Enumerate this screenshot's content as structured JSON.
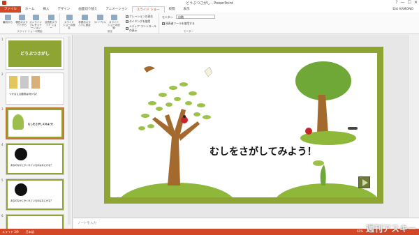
{
  "window": {
    "title": "どうぶつさがし - PowerPoint",
    "controls": [
      "?",
      "—",
      "☐",
      "✕"
    ]
  },
  "tabs": [
    "ファイル",
    "ホーム",
    "挿入",
    "デザイン",
    "画面切り替え",
    "アニメーション",
    "スライド ショー",
    "校閲",
    "表示"
  ],
  "active_tab": "スライド ショー",
  "user": "Eiki KAMONO",
  "ribbon": {
    "group_start": {
      "label": "スライド ショーの開始",
      "buttons": [
        "最初から",
        "現在のスライドから",
        "オンライン プレゼンテーション",
        "目的別スライド ショー"
      ]
    },
    "group_setup": {
      "label": "設定",
      "buttons": [
        "スライド ショーの設定",
        "非表示スライドに設定",
        "リハーサル",
        "スライド ショーの記録"
      ]
    },
    "checkboxes": [
      "ナレーションの再生",
      "タイミングを使用",
      "メディア コントロールの表示"
    ],
    "group_monitor": {
      "label": "モニター",
      "monitor_label": "モニター:",
      "monitor_value": "自動",
      "presenter_view": "発表者ツールを使用する"
    }
  },
  "thumbnails": [
    {
      "num": "1",
      "title": "どうぶつさがし"
    },
    {
      "num": "2",
      "caption": "つかまえる動物は何かな？"
    },
    {
      "num": "3",
      "caption": "むしをさがしてみよう！"
    },
    {
      "num": "4",
      "caption": "あなのなかにかくれているのはなにかな？"
    },
    {
      "num": "5",
      "caption": "あなのなかにかくれているのはなにかな？"
    },
    {
      "num": "6",
      "caption": ""
    }
  ],
  "slide": {
    "title": "むしをさがしてみよう！"
  },
  "notes_placeholder": "ノートを入力",
  "status": {
    "slide": "スライド 3/9",
    "lang": "日本語",
    "zoom": "61%",
    "watermark": "週刊アスキー"
  },
  "colors": {
    "accent": "#d24726",
    "slide_border": "#8fa533"
  }
}
